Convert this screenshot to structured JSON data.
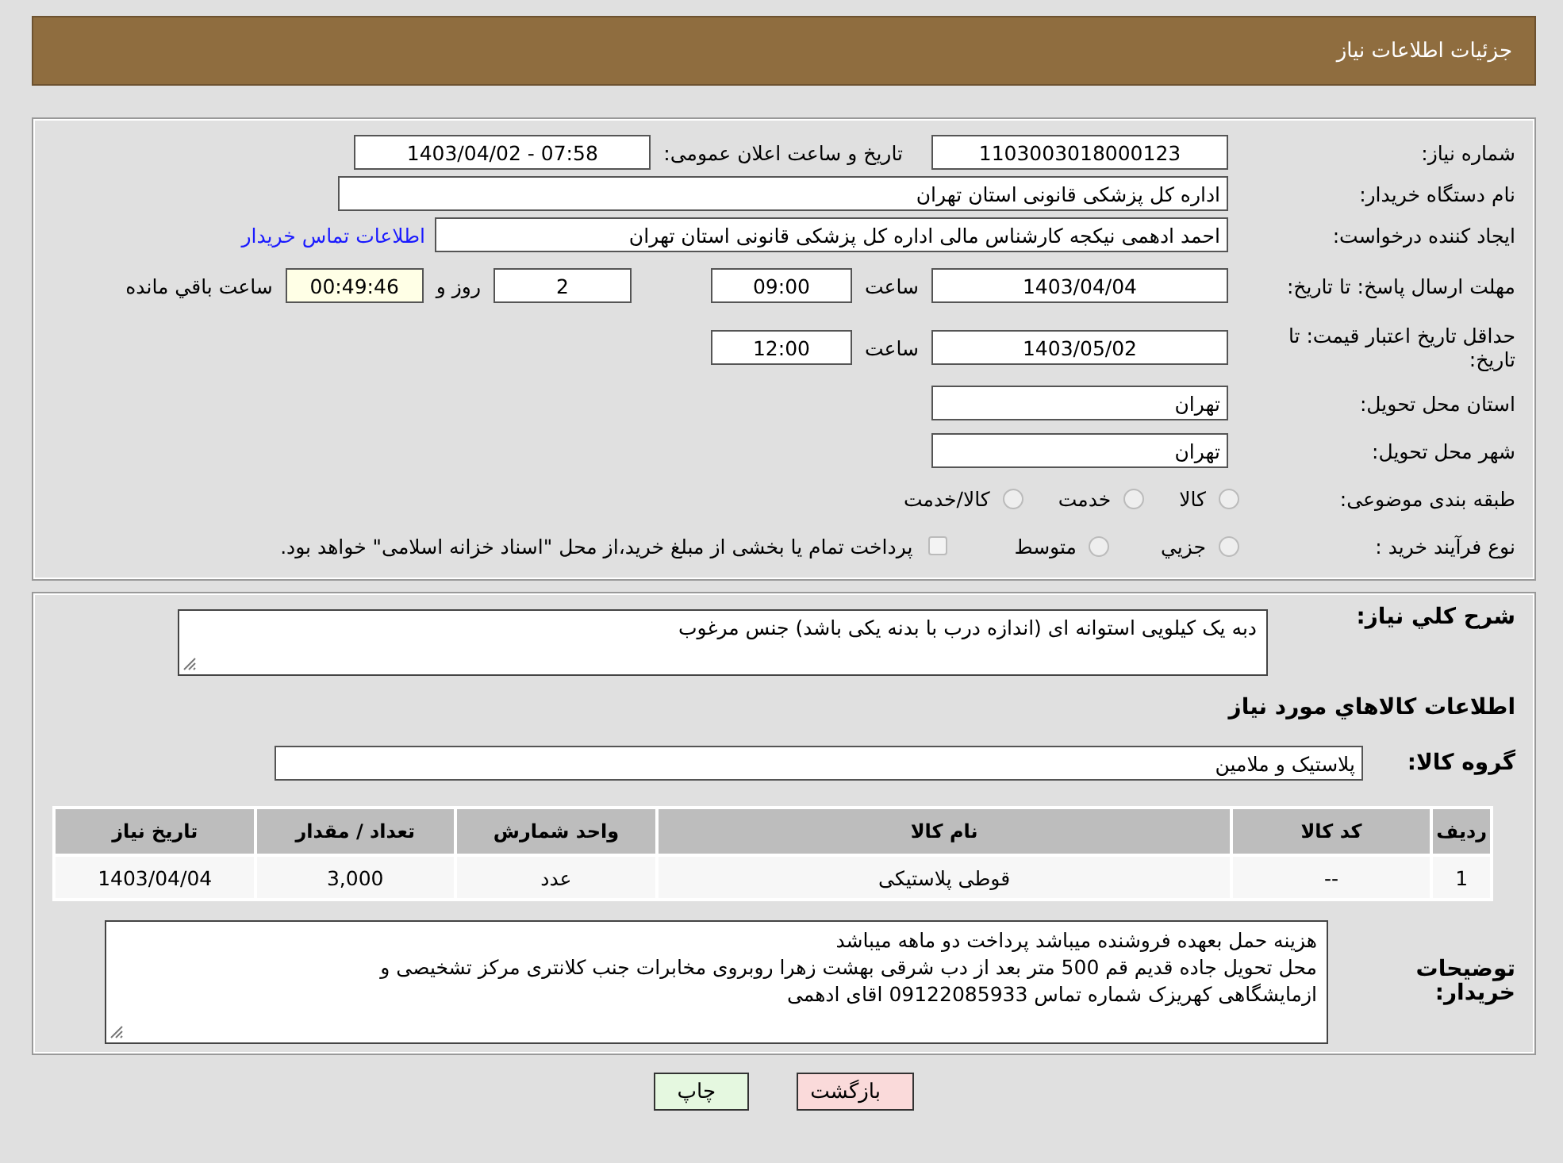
{
  "header": {
    "title": "جزئیات اطلاعات نیاز"
  },
  "info": {
    "need_number": {
      "label": "شماره نیاز:",
      "value": "1103003018000123"
    },
    "announce": {
      "label": "تاریخ و ساعت اعلان عمومی:",
      "value": "1403/04/02 - 07:58"
    },
    "buyer": {
      "label": "نام دستگاه خریدار:",
      "value": "اداره کل پزشکی قانونی استان تهران"
    },
    "creator": {
      "label": "ایجاد کننده درخواست:",
      "value": "احمد ادهمی نیکجه کارشناس مالی اداره کل پزشکی قانونی استان تهران",
      "link": "اطلاعات تماس خریدار"
    },
    "deadline": {
      "label": "مهلت ارسال پاسخ: تا تاریخ:",
      "date": "1403/04/04",
      "time_label": "ساعت",
      "time": "09:00",
      "days": "2",
      "days_label": "روز و",
      "remaining": "00:49:46",
      "remaining_label": "ساعت باقي مانده"
    },
    "validity": {
      "label": "حداقل تاریخ اعتبار قیمت: تا تاریخ:",
      "date": "1403/05/02",
      "time_label": "ساعت",
      "time": "12:00"
    },
    "province": {
      "label": "استان محل تحویل:",
      "value": "تهران"
    },
    "city": {
      "label": "شهر محل تحویل:",
      "value": "تهران"
    },
    "category": {
      "label": "طبقه بندی موضوعی:",
      "options": [
        {
          "label": "کالا",
          "selected": false
        },
        {
          "label": "خدمت",
          "selected": false
        },
        {
          "label": "کالا/خدمت",
          "selected": false
        }
      ]
    },
    "process": {
      "label": "نوع فرآیند خرید :",
      "options": [
        {
          "label": "جزيي",
          "selected": false
        },
        {
          "label": "متوسط",
          "selected": false
        }
      ],
      "payment_checkbox": {
        "checked": false,
        "label": "پرداخت تمام یا بخشی از مبلغ خرید،از محل \"اسناد خزانه اسلامی\" خواهد بود."
      }
    }
  },
  "details": {
    "description": {
      "label": "شرح کلي نياز:",
      "value": "دبه یک کیلویی استوانه ای (اندازه درب با بدنه یکی باشد) جنس مرغوب"
    },
    "section_title": "اطلاعات کالاهاي مورد نياز",
    "group": {
      "label": "گروه کالا:",
      "value": "پلاستیک و ملامین"
    },
    "table": {
      "columns": [
        "رديف",
        "کد کالا",
        "نام کالا",
        "واحد شمارش",
        "تعداد / مقدار",
        "تاریخ نیاز"
      ],
      "rows": [
        [
          "1",
          "--",
          "قوطی پلاستیکی",
          "عدد",
          "3,000",
          "1403/04/04"
        ]
      ]
    },
    "notes": {
      "label": "توضیحات خریدار:",
      "lines": [
        "هزینه حمل بعهده فروشنده میباشد پرداخت دو ماهه میباشد",
        "محل تحویل جاده قدیم قم 500 متر بعد از دب شرقی بهشت زهرا روبروی مخابرات جنب کلانتری مرکز تشخیصی و",
        "ازمایشگاهی کهریزک شماره تماس 09122085933 اقای ادهمی"
      ]
    }
  },
  "buttons": [
    {
      "label": "بازگشت",
      "kind": "back"
    },
    {
      "label": "چاپ",
      "kind": "print"
    }
  ]
}
